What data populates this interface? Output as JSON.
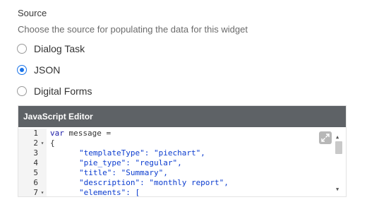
{
  "source": {
    "title": "Source",
    "description": "Choose the source for populating the data for this widget",
    "options": [
      {
        "label": "Dialog Task",
        "selected": false
      },
      {
        "label": "JSON",
        "selected": true
      },
      {
        "label": "Digital Forms",
        "selected": false
      }
    ]
  },
  "editor": {
    "title": "JavaScript Editor",
    "lines": [
      {
        "num": "1",
        "text": "var message ="
      },
      {
        "num": "2",
        "text": "{"
      },
      {
        "num": "3",
        "text": "\"templateType\": \"piechart\","
      },
      {
        "num": "4",
        "text": "\"pie_type\": \"regular\","
      },
      {
        "num": "5",
        "text": "\"title\": \"Summary\","
      },
      {
        "num": "6",
        "text": "\"description\": \"monthly report\","
      },
      {
        "num": "7",
        "text": "\"elements\": ["
      }
    ]
  },
  "colors": {
    "accent": "#1a73e8",
    "editor_header": "#5e6266"
  }
}
